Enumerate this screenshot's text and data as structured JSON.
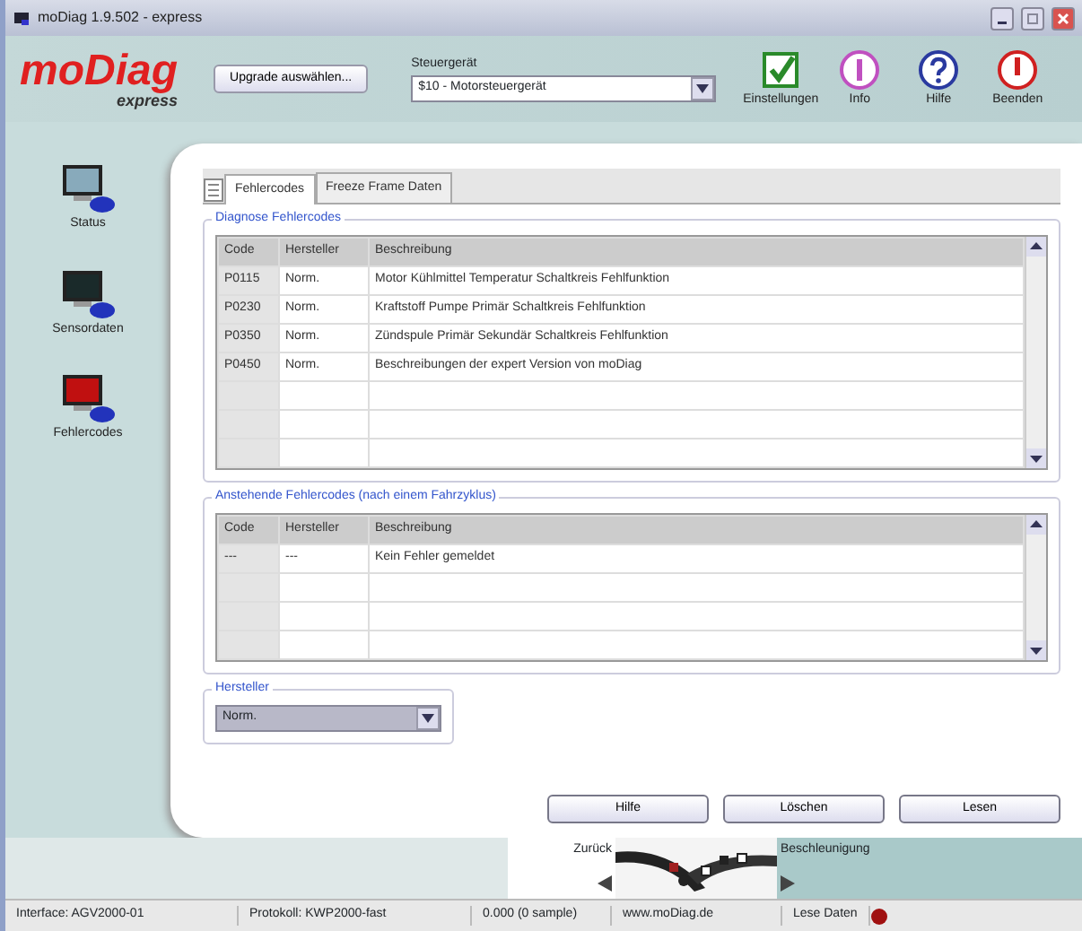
{
  "window": {
    "title": "moDiag 1.9.502 - express"
  },
  "header": {
    "logo": "moDiag",
    "logo_sub": "express",
    "upgrade_button": "Upgrade auswählen...",
    "ecu_label": "Steuergerät",
    "ecu_value": "$10 - Motorsteuergerät",
    "tools": [
      {
        "kind": "settings",
        "label": "Einstellungen"
      },
      {
        "kind": "info",
        "label": "Info"
      },
      {
        "kind": "help",
        "label": "Hilfe"
      },
      {
        "kind": "exit",
        "label": "Beenden"
      }
    ]
  },
  "sidebar": {
    "items": [
      {
        "kind": "status",
        "label": "Status"
      },
      {
        "kind": "sensor",
        "label": "Sensordaten"
      },
      {
        "kind": "error",
        "label": "Fehlercodes"
      }
    ]
  },
  "tabs": [
    {
      "label": "Fehlercodes",
      "selected": true
    },
    {
      "label": "Freeze Frame Daten",
      "selected": false
    }
  ],
  "diagnose": {
    "title": "Diagnose Fehlercodes",
    "columns": [
      "Code",
      "Hersteller",
      "Beschreibung"
    ],
    "rows": [
      [
        "P0115",
        "Norm.",
        "Motor Kühlmittel Temperatur Schaltkreis Fehlfunktion"
      ],
      [
        "P0230",
        "Norm.",
        "Kraftstoff Pumpe Primär Schaltkreis Fehlfunktion"
      ],
      [
        "P0350",
        "Norm.",
        "Zündspule Primär Sekundär Schaltkreis Fehlfunktion"
      ],
      [
        "P0450",
        "Norm.",
        "Beschreibungen der expert Version von moDiag"
      ]
    ]
  },
  "pending": {
    "title": "Anstehende Fehlercodes (nach einem Fahrzyklus)",
    "columns": [
      "Code",
      "Hersteller",
      "Beschreibung"
    ],
    "rows": [
      [
        "---",
        "---",
        "Kein Fehler gemeldet"
      ]
    ]
  },
  "manufacturer": {
    "title": "Hersteller",
    "value": "Norm."
  },
  "buttons": [
    "Hilfe",
    "Löschen",
    "Lesen"
  ],
  "nav": {
    "back": "Zurück",
    "next": "Beschleunigung"
  },
  "status_bar": [
    "Interface: AGV2000-01",
    "Protokoll: KWP2000-fast",
    "0.000 (0 sample)",
    "www.moDiag.de",
    "Lese Daten"
  ]
}
